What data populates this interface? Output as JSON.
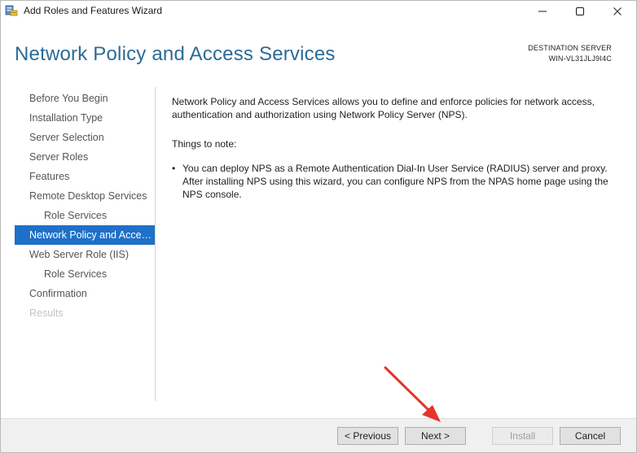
{
  "window": {
    "title": "Add Roles and Features Wizard",
    "icons": {
      "app": "server-manager-icon",
      "minimize": "minimize-icon",
      "maximize": "maximize-icon",
      "close": "close-icon"
    }
  },
  "header": {
    "page_title": "Network Policy and Access Services",
    "destination_label": "DESTINATION SERVER",
    "destination_server": "WIN-VL31JLJ9I4C"
  },
  "nav": {
    "items": [
      {
        "label": "Before You Begin",
        "state": "normal"
      },
      {
        "label": "Installation Type",
        "state": "normal"
      },
      {
        "label": "Server Selection",
        "state": "normal"
      },
      {
        "label": "Server Roles",
        "state": "normal"
      },
      {
        "label": "Features",
        "state": "normal"
      },
      {
        "label": "Remote Desktop Services",
        "state": "normal"
      },
      {
        "label": "Role Services",
        "state": "sub"
      },
      {
        "label": "Network Policy and Access Services",
        "state": "active"
      },
      {
        "label": "Web Server Role (IIS)",
        "state": "normal"
      },
      {
        "label": "Role Services",
        "state": "sub"
      },
      {
        "label": "Confirmation",
        "state": "normal"
      },
      {
        "label": "Results",
        "state": "disabled"
      }
    ]
  },
  "content": {
    "intro": "Network Policy and Access Services allows you to define and enforce policies for network access, authentication and authorization using Network Policy Server (NPS).",
    "notes_heading": "Things to note:",
    "bullet_symbol": "•",
    "notes": [
      "You can deploy NPS as a Remote Authentication Dial-In User Service (RADIUS) server and proxy. After installing NPS using this wizard,  you can configure NPS from the NPAS home page using the NPS console."
    ]
  },
  "buttons": {
    "previous": "< Previous",
    "next": "Next >",
    "install": "Install",
    "cancel": "Cancel"
  },
  "colors": {
    "title_accent": "#2b6b96",
    "nav_active_bg": "#1f70c8",
    "annotation_arrow": "#e8322c"
  }
}
